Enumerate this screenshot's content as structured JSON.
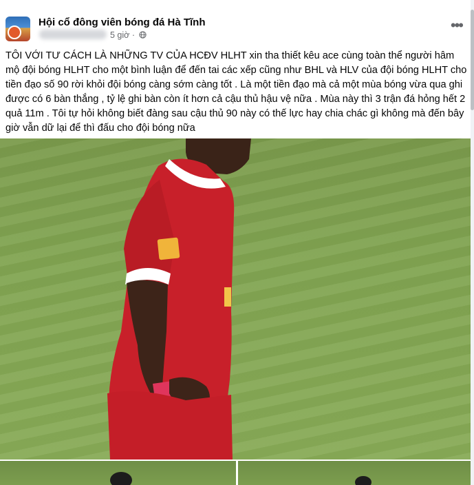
{
  "post": {
    "group_name": "Hội cổ đông viên bóng đá Hà Tĩnh",
    "time": "5 giờ",
    "separator": "·",
    "more_label": "•••",
    "text": "TÔI VỚI TƯ CÁCH LÀ NHỮNG TV CỦA HCĐV HLHT xin tha thiết kêu ace cùng toàn thể người hâm mộ đội bóng HLHT cho một bình luận để đến tai các xếp cũng như BHL và HLV của đội bóng HLHT cho tiền đạo số 90 rời khỏi đội bóng càng sớm càng tốt . Là một tiền đạo mà cả một mùa bóng vừa qua ghi được có 6 bàn thắng , tỷ lệ ghi bàn còn ít hơn cả cậu thủ hậu vệ nữa . Mùa này thì 3 trận đá hỏng hết 2 quả 11m . Tôi tự hỏi không biết đàng sau cậu thủ 90 này có thế lực hay chia chác gì không mà đến bây giờ vẫn dữ lại để thì đấu cho đội bóng nữa"
  },
  "icons": {
    "globe": "globe-icon",
    "more": "more-options-icon"
  },
  "colors": {
    "jersey_red": "#c8202a",
    "grass_green": "#82a552",
    "meta_gray": "#65676b"
  }
}
